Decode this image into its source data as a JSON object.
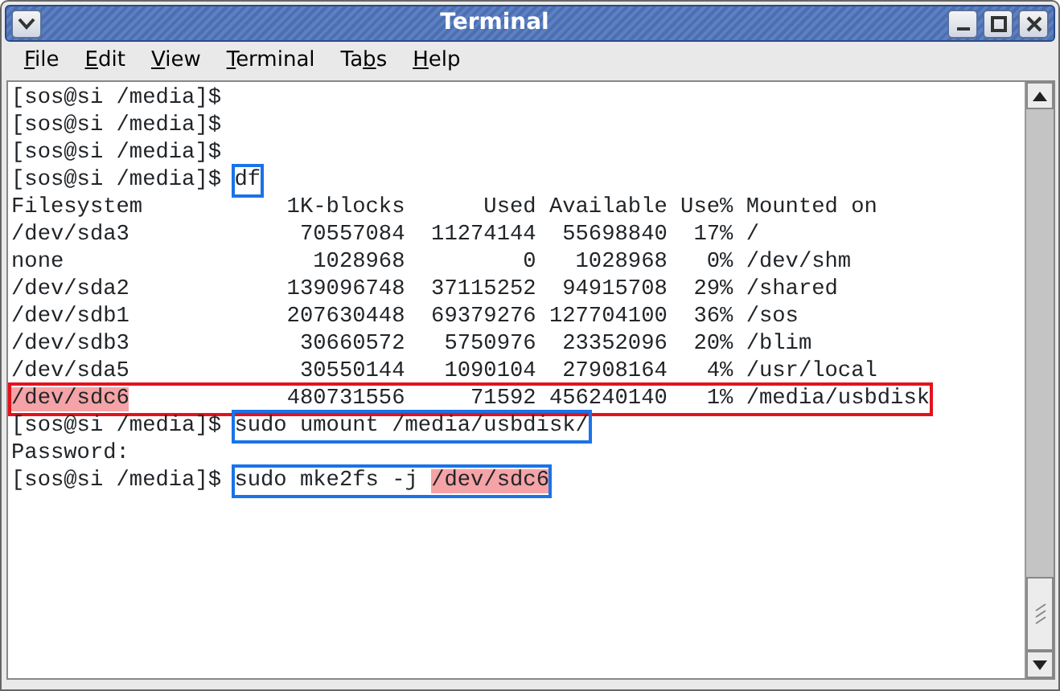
{
  "window": {
    "title": "Terminal"
  },
  "menu": [
    {
      "label": [
        {
          "text": "F",
          "underlined": true
        },
        {
          "text": "ile"
        }
      ]
    },
    {
      "label": [
        {
          "text": "E",
          "underlined": true
        },
        {
          "text": "dit"
        }
      ]
    },
    {
      "label": [
        {
          "text": "V",
          "underlined": true
        },
        {
          "text": "iew"
        }
      ]
    },
    {
      "label": [
        {
          "text": "T",
          "underlined": true
        },
        {
          "text": "erminal"
        }
      ]
    },
    {
      "label": [
        {
          "text": "Ta"
        },
        {
          "text": "b",
          "underlined": true
        },
        {
          "text": "s"
        }
      ]
    },
    {
      "label": [
        {
          "text": "H",
          "underlined": true
        },
        {
          "text": "elp"
        }
      ]
    }
  ],
  "lines": [
    {
      "groups": [
        {
          "parts": [
            {
              "text": "[sos@si /media]$"
            }
          ]
        }
      ]
    },
    {
      "groups": [
        {
          "parts": [
            {
              "text": "[sos@si /media]$"
            }
          ]
        }
      ]
    },
    {
      "groups": [
        {
          "parts": [
            {
              "text": "[sos@si /media]$"
            }
          ]
        }
      ]
    },
    {
      "groups": [
        {
          "parts": [
            {
              "text": "[sos@si /media]$ "
            }
          ]
        },
        {
          "color": "#1a73e8",
          "parts": [
            {
              "text": "df"
            }
          ]
        }
      ]
    },
    {
      "groups": [
        {
          "parts": [
            {
              "text": "Filesystem           1K-blocks      Used Available Use% Mounted on"
            }
          ]
        }
      ]
    },
    {
      "groups": [
        {
          "parts": [
            {
              "text": "/dev/sda3             70557084  11274144  55698840  17% /"
            }
          ]
        }
      ]
    },
    {
      "groups": [
        {
          "parts": [
            {
              "text": "none                   1028968         0   1028968   0% /dev/shm"
            }
          ]
        }
      ]
    },
    {
      "groups": [
        {
          "parts": [
            {
              "text": "/dev/sda2            139096748  37115252  94915708  29% /shared"
            }
          ]
        }
      ]
    },
    {
      "groups": [
        {
          "parts": [
            {
              "text": "/dev/sdb1            207630448  69379276 127704100  36% /sos"
            }
          ]
        }
      ]
    },
    {
      "groups": [
        {
          "parts": [
            {
              "text": "/dev/sdb3             30660572   5750976  23352096  20% /blim"
            }
          ]
        }
      ]
    },
    {
      "groups": [
        {
          "parts": [
            {
              "text": "/dev/sda5             30550144   1090104  27908164   4% /usr/local"
            }
          ]
        }
      ]
    },
    {
      "groups": [
        {
          "color": "#e3121d",
          "parts": [
            {
              "text": "/dev/sdc6",
              "highlight": true
            },
            {
              "text": "            480731556     71592 456240140   1% /media/usbdisk"
            }
          ]
        }
      ]
    },
    {
      "groups": [
        {
          "parts": [
            {
              "text": "[sos@si /media]$ "
            }
          ]
        },
        {
          "color": "#1a73e8",
          "parts": [
            {
              "text": "sudo umount /media/usbdisk/"
            }
          ]
        }
      ]
    },
    {
      "groups": [
        {
          "parts": [
            {
              "text": "Password:"
            }
          ]
        }
      ]
    },
    {
      "groups": [
        {
          "parts": [
            {
              "text": "[sos@si /media]$ "
            }
          ]
        },
        {
          "color": "#1a73e8",
          "parts": [
            {
              "text": "sudo mke2fs -j "
            },
            {
              "text": "/dev/sdc6",
              "highlight": true
            }
          ]
        }
      ]
    }
  ]
}
